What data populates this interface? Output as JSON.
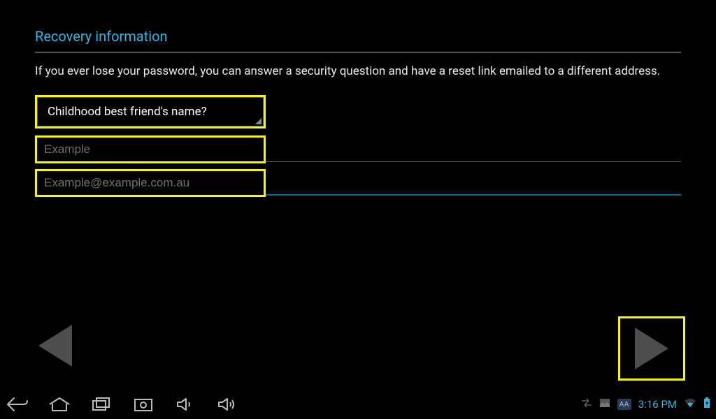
{
  "title": "Recovery information",
  "description": "If you ever lose your password, you can answer a security question and have a reset link emailed to a different address.",
  "security_question": {
    "selected": "Childhood best friend's name?"
  },
  "answer_field": {
    "value": "",
    "placeholder": "Example"
  },
  "recovery_email_field": {
    "value": "",
    "placeholder": "Example@example.com.au"
  },
  "statusbar": {
    "aa_label": "AA",
    "clock": "3:16 PM"
  },
  "colors": {
    "accent": "#33b5e5",
    "highlight_border": "#f7f700"
  }
}
